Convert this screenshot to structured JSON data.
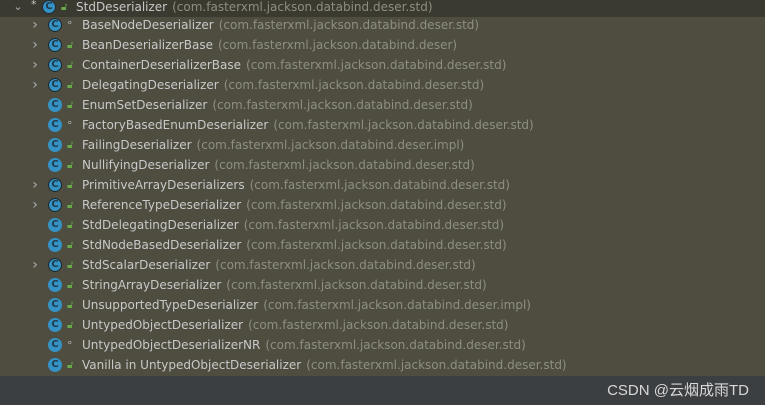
{
  "tree": {
    "root": {
      "name": "StdDeserializer",
      "package": "(com.fasterxml.jackson.databind.deser.std)",
      "expanded": true
    },
    "children": [
      {
        "name": "BaseNodeDeserializer",
        "package": "(com.fasterxml.jackson.databind.deser.std)",
        "expandable": true,
        "visibility": "package"
      },
      {
        "name": "BeanDeserializerBase",
        "package": "(com.fasterxml.jackson.databind.deser)",
        "expandable": true,
        "visibility": "public"
      },
      {
        "name": "ContainerDeserializerBase",
        "package": "(com.fasterxml.jackson.databind.deser.std)",
        "expandable": true,
        "visibility": "public"
      },
      {
        "name": "DelegatingDeserializer",
        "package": "(com.fasterxml.jackson.databind.deser.std)",
        "expandable": true,
        "visibility": "public"
      },
      {
        "name": "EnumSetDeserializer",
        "package": "(com.fasterxml.jackson.databind.deser.std)",
        "expandable": false,
        "visibility": "public"
      },
      {
        "name": "FactoryBasedEnumDeserializer",
        "package": "(com.fasterxml.jackson.databind.deser.std)",
        "expandable": false,
        "visibility": "package"
      },
      {
        "name": "FailingDeserializer",
        "package": "(com.fasterxml.jackson.databind.deser.impl)",
        "expandable": false,
        "visibility": "public"
      },
      {
        "name": "NullifyingDeserializer",
        "package": "(com.fasterxml.jackson.databind.deser.std)",
        "expandable": false,
        "visibility": "public"
      },
      {
        "name": "PrimitiveArrayDeserializers",
        "package": "(com.fasterxml.jackson.databind.deser.std)",
        "expandable": true,
        "visibility": "public"
      },
      {
        "name": "ReferenceTypeDeserializer",
        "package": "(com.fasterxml.jackson.databind.deser.std)",
        "expandable": true,
        "visibility": "public"
      },
      {
        "name": "StdDelegatingDeserializer",
        "package": "(com.fasterxml.jackson.databind.deser.std)",
        "expandable": false,
        "visibility": "public"
      },
      {
        "name": "StdNodeBasedDeserializer",
        "package": "(com.fasterxml.jackson.databind.deser.std)",
        "expandable": false,
        "visibility": "public"
      },
      {
        "name": "StdScalarDeserializer",
        "package": "(com.fasterxml.jackson.databind.deser.std)",
        "expandable": true,
        "visibility": "public"
      },
      {
        "name": "StringArrayDeserializer",
        "package": "(com.fasterxml.jackson.databind.deser.std)",
        "expandable": false,
        "visibility": "public"
      },
      {
        "name": "UnsupportedTypeDeserializer",
        "package": "(com.fasterxml.jackson.databind.deser.impl)",
        "expandable": false,
        "visibility": "public"
      },
      {
        "name": "UntypedObjectDeserializer",
        "package": "(com.fasterxml.jackson.databind.deser.std)",
        "expandable": false,
        "visibility": "public"
      },
      {
        "name": "UntypedObjectDeserializerNR",
        "package": "(com.fasterxml.jackson.databind.deser.std)",
        "expandable": false,
        "visibility": "package"
      },
      {
        "name": "Vanilla in UntypedObjectDeserializer",
        "package": "(com.fasterxml.jackson.databind.deser.std)",
        "expandable": false,
        "visibility": "public"
      }
    ]
  },
  "icons": {
    "class": "class-icon",
    "public": "unlock-icon",
    "package": "package-private-dot-icon"
  },
  "colors": {
    "background": "#4e4d40",
    "class_icon": "#3592c4",
    "public_lock": "#6aab4a",
    "name_text": "#c9c9c9",
    "package_text": "#8e8e82"
  },
  "watermark": "CSDN @云烟成雨TD"
}
